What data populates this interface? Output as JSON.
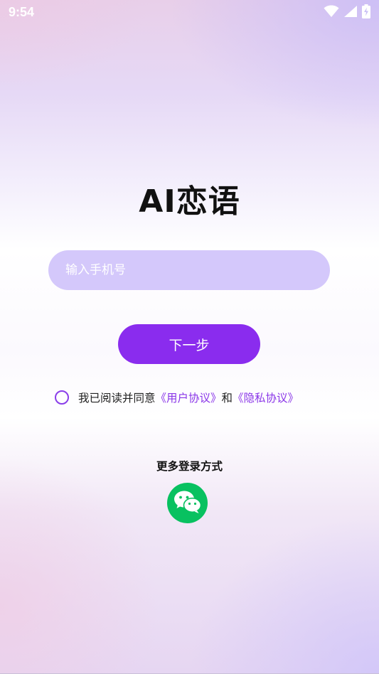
{
  "status_bar": {
    "time": "9:54",
    "icons": [
      "wifi-icon",
      "cellular-signal-icon",
      "battery-charging-icon"
    ]
  },
  "app": {
    "title": "AI恋语"
  },
  "login": {
    "phone_placeholder": "输入手机号",
    "phone_value": "",
    "next_label": "下一步"
  },
  "agreement": {
    "checked": false,
    "prefix": "我已阅读并同意",
    "user_agreement": "《用户协议》",
    "conjunction": "和",
    "privacy_policy": "《隐私协议》"
  },
  "more_login": {
    "label": "更多登录方式",
    "options": [
      "wechat-icon"
    ]
  },
  "colors": {
    "accent": "#8a2cee",
    "input_background": "#d4c8fb",
    "link": "#8a36e8",
    "wechat_green": "#08c160"
  }
}
